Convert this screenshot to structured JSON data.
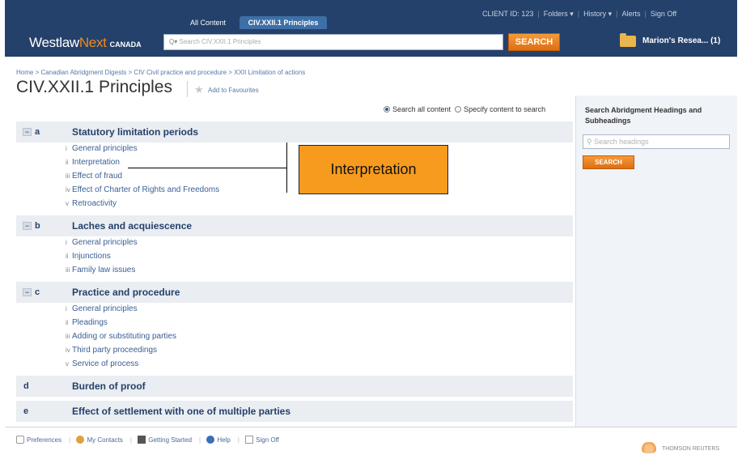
{
  "header": {
    "tabs": [
      {
        "label": "All Content"
      },
      {
        "label": "CIV.XXII.1 Principles"
      }
    ],
    "topnav": {
      "client_id": "CLIENT ID: 123",
      "folders": "Folders ▾",
      "history": "History ▾",
      "alerts": "Alerts",
      "sign_off": "Sign Off"
    },
    "logo_main": "Westlaw",
    "logo_next": "Next",
    "logo_country": "CANADA",
    "search_prefix": "Q▾",
    "search_placeholder": "Search CIV.XXII.1 Principles",
    "search_button": "SEARCH",
    "research_folder": "Marion's Resea... (1)"
  },
  "breadcrumb": "Home > Canadian Abridgment Digests > CIV Civil practice and procedure > XXII Limitation of actions",
  "page_title": "CIV.XXII.1 Principles",
  "add_to_favourites": "Add to Favourites",
  "scope": {
    "option1": "Search all content",
    "option2": "Specify content to search"
  },
  "sections": [
    {
      "letter": "a",
      "title": "Statutory limitation periods",
      "items": [
        {
          "num": "i",
          "label": "General principles"
        },
        {
          "num": "ii",
          "label": "Interpretation"
        },
        {
          "num": "iii",
          "label": "Effect of fraud"
        },
        {
          "num": "iv",
          "label": "Effect of Charter of Rights and Freedoms"
        },
        {
          "num": "v",
          "label": "Retroactivity"
        }
      ]
    },
    {
      "letter": "b",
      "title": "Laches and acquiescence",
      "items": [
        {
          "num": "i",
          "label": "General principles"
        },
        {
          "num": "ii",
          "label": "Injunctions"
        },
        {
          "num": "iii",
          "label": "Family law issues"
        }
      ]
    },
    {
      "letter": "c",
      "title": "Practice and procedure",
      "items": [
        {
          "num": "i",
          "label": "General principles"
        },
        {
          "num": "ii",
          "label": "Pleadings"
        },
        {
          "num": "iii",
          "label": "Adding or substituting parties"
        },
        {
          "num": "iv",
          "label": "Third party proceedings"
        },
        {
          "num": "v",
          "label": "Service of process"
        }
      ]
    },
    {
      "letter": "d",
      "title": "Burden of proof",
      "items": []
    },
    {
      "letter": "e",
      "title": "Effect of settlement with one of multiple parties",
      "items": []
    }
  ],
  "callout": "Interpretation",
  "right_panel": {
    "title": "Search Abridgment Headings and Subheadings",
    "placeholder": "Search headings",
    "button": "SEARCH"
  },
  "footer": {
    "preferences": "Preferences",
    "contacts": "My Contacts",
    "getting_started": "Getting Started",
    "help": "Help",
    "sign_off": "Sign Off",
    "brand": "THOMSON REUTERS"
  },
  "colors": {
    "header_bg": "#24416b",
    "accent_orange": "#f08a1c",
    "callout_bg": "#f79b1e",
    "link_blue": "#3a5f94"
  }
}
